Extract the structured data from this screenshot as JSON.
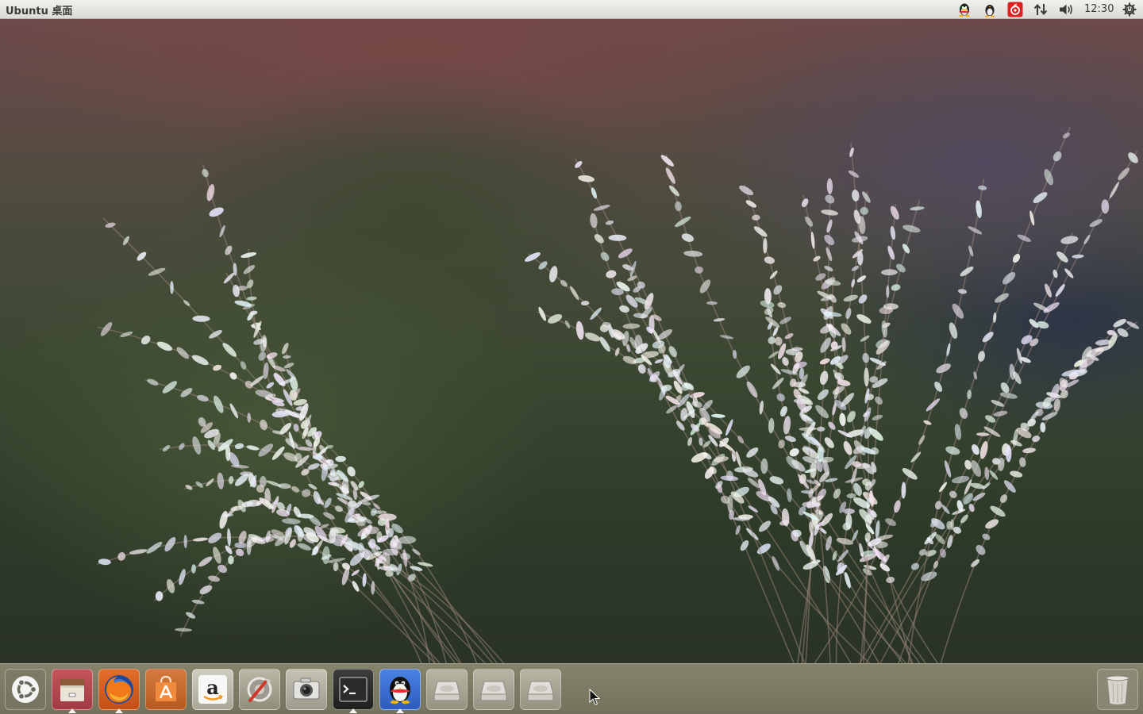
{
  "top_panel": {
    "title": "Ubuntu 桌面",
    "clock": "12:30",
    "tray_icons": [
      "qq-icon",
      "tux-icon",
      "netease-music-icon",
      "network-icon",
      "volume-icon",
      "power-gear-icon"
    ]
  },
  "launcher": {
    "items": [
      {
        "name": "ubuntu-dash-button",
        "icon": "ubuntu-logo-icon"
      },
      {
        "name": "files-button",
        "icon": "file-cabinet-icon",
        "running": true
      },
      {
        "name": "firefox-button",
        "icon": "firefox-icon",
        "running": true
      },
      {
        "name": "software-center-button",
        "icon": "shopping-bag-icon"
      },
      {
        "name": "amazon-button",
        "icon": "amazon-icon"
      },
      {
        "name": "system-settings-button",
        "icon": "wrench-screwdriver-icon"
      },
      {
        "name": "camera-button",
        "icon": "camera-icon"
      },
      {
        "name": "terminal-button",
        "icon": "terminal-icon",
        "running": true
      },
      {
        "name": "qq-app-button",
        "icon": "qq-penguin-icon",
        "running": true
      },
      {
        "name": "drive-1-button",
        "icon": "hard-drive-icon"
      },
      {
        "name": "drive-2-button",
        "icon": "hard-drive-icon"
      },
      {
        "name": "drive-3-button",
        "icon": "hard-drive-icon"
      },
      {
        "name": "trash-button",
        "icon": "trash-icon"
      }
    ]
  },
  "colors": {
    "panel": "#dcdad5",
    "panel_text": "#3c3b37",
    "launcher": "#8c8a70",
    "files_tile": "#b9474f",
    "firefox_tile": "#d05a1c",
    "software_tile": "#c76a32",
    "terminal_tile": "#2e2e2e",
    "qq_tile": "#3a6fd0"
  }
}
